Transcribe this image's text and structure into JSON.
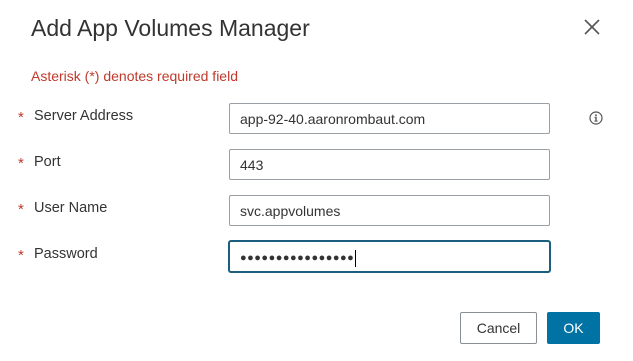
{
  "dialog": {
    "title": "Add App Volumes Manager",
    "close_icon": "close-x-icon",
    "required_note": "Asterisk (*) denotes required field"
  },
  "form": {
    "fields": [
      {
        "label": "Server Address",
        "required_marker": "*",
        "value": "app-92-40.aaronrombaut.com",
        "info_icon": "info-circle-icon"
      },
      {
        "label": "Port",
        "required_marker": "*",
        "value": "443"
      },
      {
        "label": "User Name",
        "required_marker": "*",
        "value": "svc.appvolumes"
      },
      {
        "label": "Password",
        "required_marker": "*",
        "value": "●●●●●●●●●●●●●●●●",
        "focused": true
      }
    ]
  },
  "buttons": {
    "cancel_label": "Cancel",
    "ok_label": "OK",
    "ok_color": "#0072a3"
  },
  "colors": {
    "required": "#c0392b",
    "focus_border": "#1b5e7d"
  }
}
